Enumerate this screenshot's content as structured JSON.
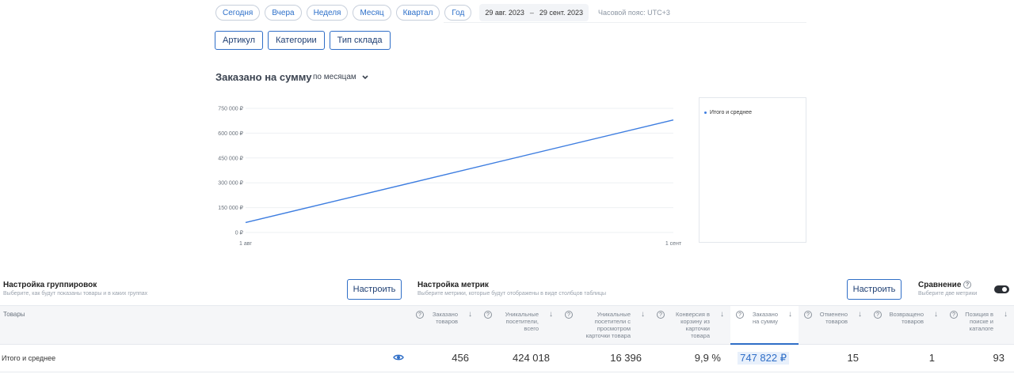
{
  "periods": [
    "Сегодня",
    "Вчера",
    "Неделя",
    "Месяц",
    "Квартал",
    "Год"
  ],
  "date_range": {
    "from": "29 авг. 2023",
    "sep": "–",
    "to": "29 сент. 2023"
  },
  "timezone": "Часовой пояс: UTC+3",
  "dimensions": [
    "Артикул",
    "Категории",
    "Тип склада"
  ],
  "chart_header": {
    "title": "Заказано на сумму",
    "period": "по месяцам"
  },
  "chart_data": {
    "type": "line",
    "x": [
      "1 авг",
      "1 сент"
    ],
    "series": [
      {
        "name": "Итого и среднее",
        "values": [
          60000,
          680000
        ],
        "color": "#3d7de0"
      }
    ],
    "yticks": [
      "0 ₽",
      "150 000 ₽",
      "300 000 ₽",
      "450 000 ₽",
      "600 000 ₽",
      "750 000 ₽"
    ],
    "ylim": [
      0,
      750000
    ],
    "grid": true,
    "legend_position": "right"
  },
  "grouping": {
    "title": "Настройка группировок",
    "subtitle": "Выберите, как будут показаны товары и в каких группах",
    "button": "Настроить"
  },
  "metrics": {
    "title": "Настройка метрик",
    "subtitle": "Выберите метрики, которые будут отображены в виде столбцов таблицы",
    "button": "Настроить"
  },
  "comparison": {
    "title": "Сравнение",
    "subtitle": "Выберите две метрики"
  },
  "table": {
    "products_header": "Товары",
    "columns": [
      [
        "Заказано",
        "товаров"
      ],
      [
        "Уникальные",
        "посетители,",
        "всего"
      ],
      [
        "Уникальные",
        "посетители с",
        "просмотром",
        "карточки товара"
      ],
      [
        "Конверсия в",
        "корзину из",
        "карточки",
        "товара"
      ],
      [
        "Заказано",
        "на сумму"
      ],
      [
        "Отменено",
        "товаров"
      ],
      [
        "Возвращено",
        "товаров"
      ],
      [
        "Позиция в",
        "поиске и",
        "каталоге"
      ]
    ],
    "row": {
      "label": "Итого и среднее",
      "values": [
        "456",
        "424 018",
        "16 396",
        "9,9 %",
        "747 822 ₽",
        "15",
        "1",
        "93"
      ]
    }
  },
  "colors": {
    "accent": "#2f6ec7",
    "line": "#3d7de0"
  }
}
